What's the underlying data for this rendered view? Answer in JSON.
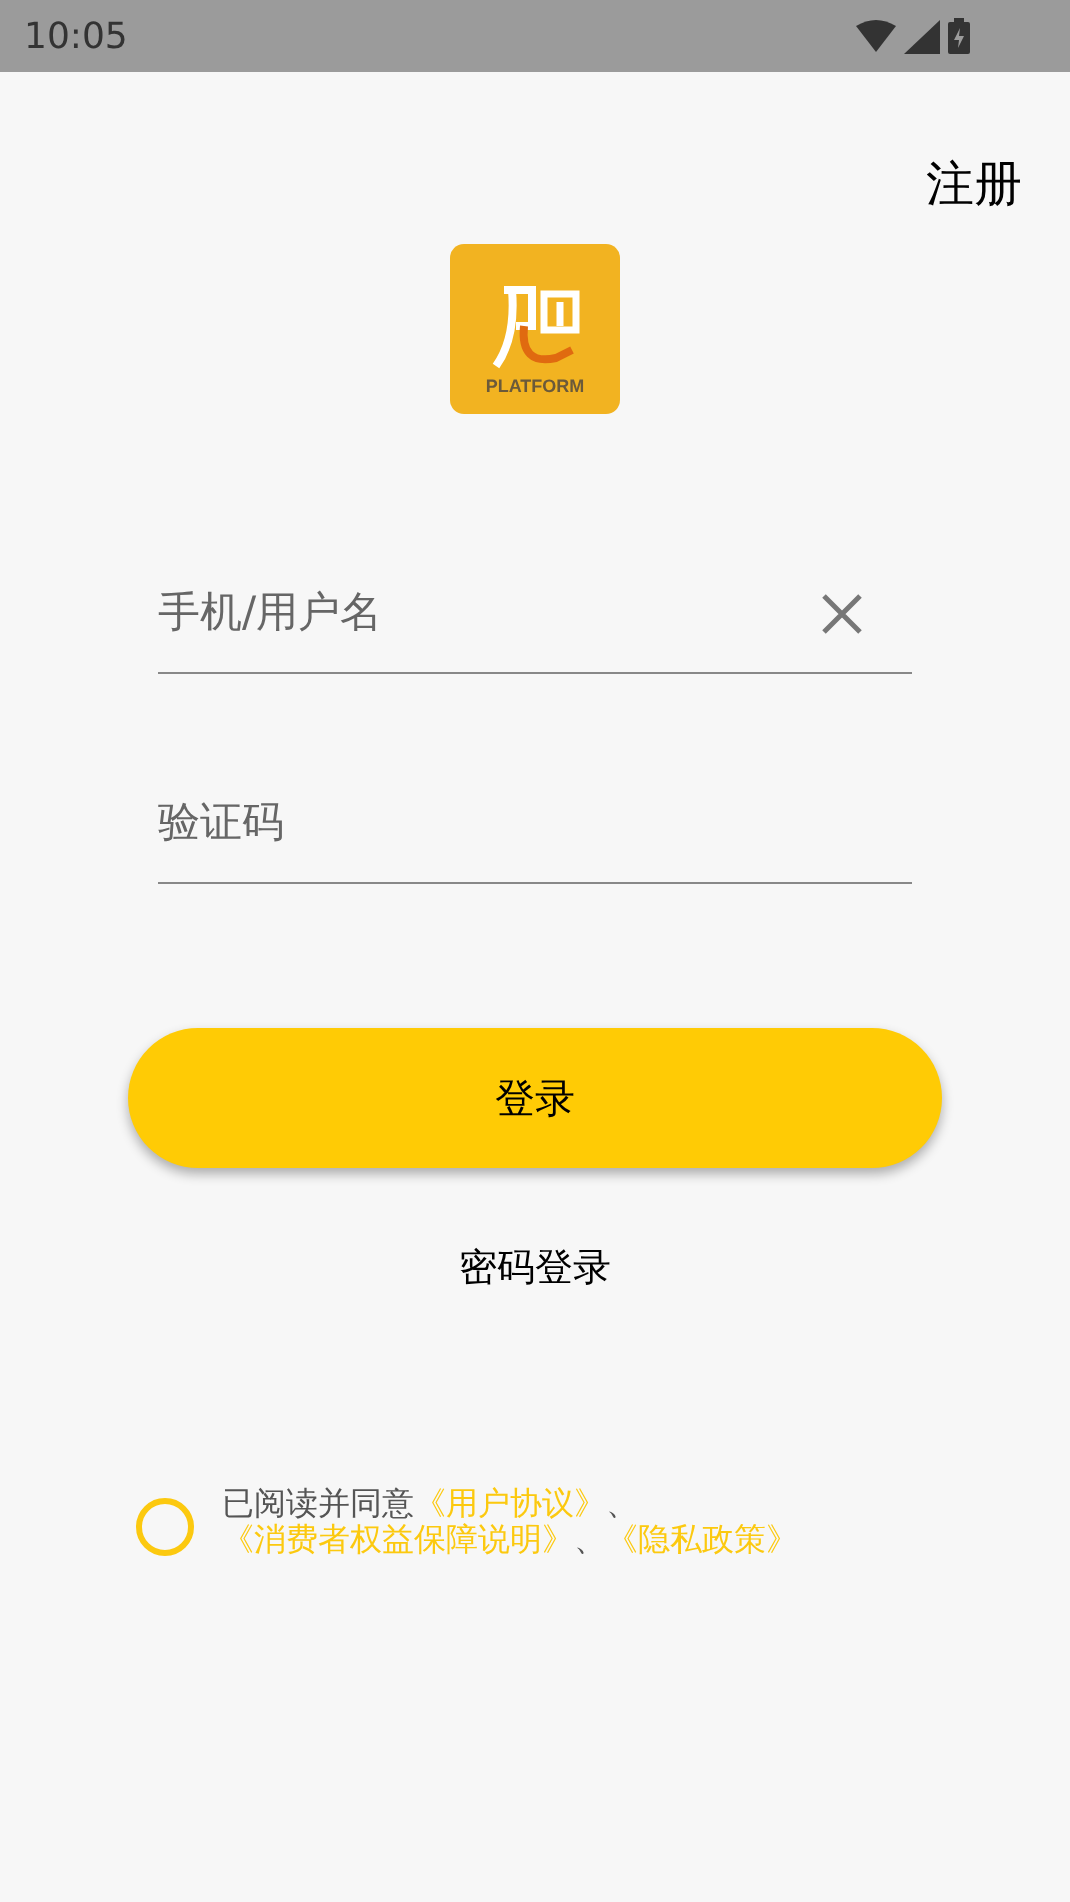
{
  "status_bar": {
    "time": "10:05"
  },
  "register_link": "注册",
  "logo": {
    "caption": "PLATFORM"
  },
  "fields": [
    {
      "placeholder": "手机/用户名",
      "clearable": true
    },
    {
      "placeholder": "验证码",
      "clearable": false
    }
  ],
  "login_button": "登录",
  "password_login_link": "密码登录",
  "agreement": {
    "checked": false,
    "parts": [
      {
        "kind": "text",
        "text": "已阅读并同意"
      },
      {
        "kind": "link",
        "text": "《用户协议》"
      },
      {
        "kind": "text",
        "text": "、"
      },
      {
        "kind": "link",
        "text": "《消费者权益保障说明》"
      },
      {
        "kind": "text",
        "text": "、"
      },
      {
        "kind": "link",
        "text": "《隐私政策》"
      }
    ]
  }
}
